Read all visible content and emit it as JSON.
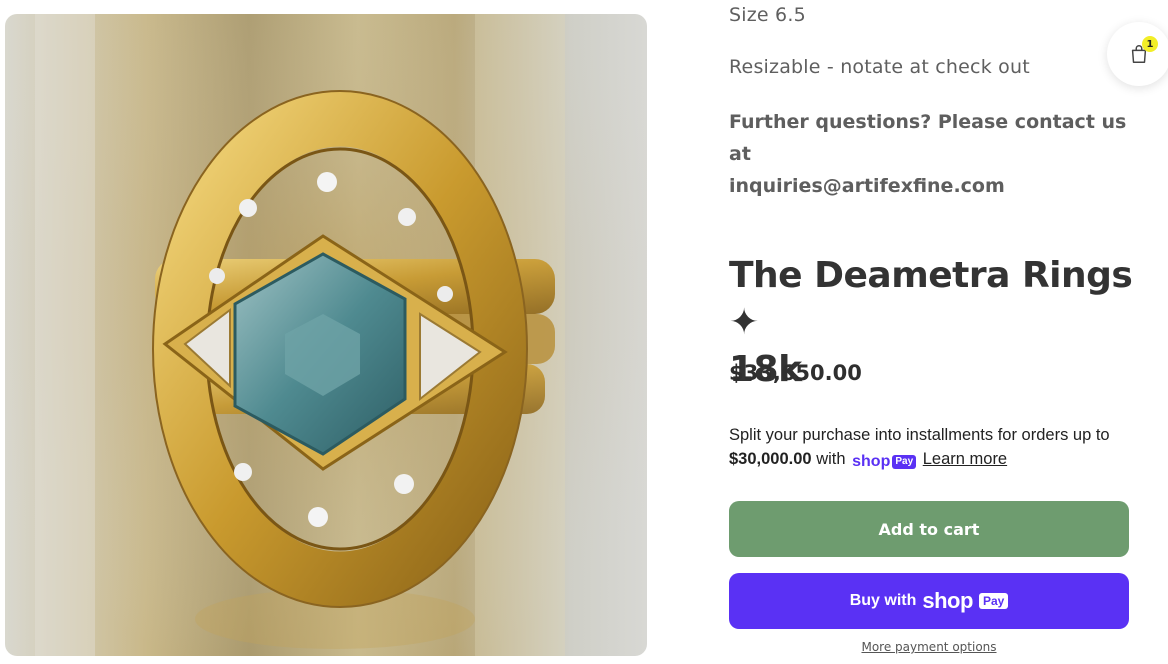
{
  "product": {
    "size_line": "Size 6.5",
    "resize_line": "Resizable - notate at check out",
    "questions_line1": "Further questions? Please contact us at",
    "questions_line2": "inquiries@artifexfine.com",
    "title_line1": "The Deametra Rings ✦",
    "title_line2": "18k",
    "price": "$33,650.00",
    "image_alt": "Gold ring with hexagonal blue-green sapphire"
  },
  "installments": {
    "text_before": "Split your purchase into installments for orders up to",
    "limit": "$30,000.00",
    "with": "with",
    "shop_word": "shop",
    "pay_word": "Pay",
    "learn_more": "Learn more"
  },
  "buttons": {
    "add_to_cart": "Add to cart",
    "buy_with": "Buy with",
    "shop_word": "shop",
    "pay_word": "Pay",
    "more_payment": "More payment options"
  },
  "cart": {
    "count": "1",
    "icon": "shopping-bag-icon"
  },
  "colors": {
    "cart_button": "#6e9c6f",
    "shop_pay": "#5a31f4",
    "badge": "#f2ee28"
  }
}
